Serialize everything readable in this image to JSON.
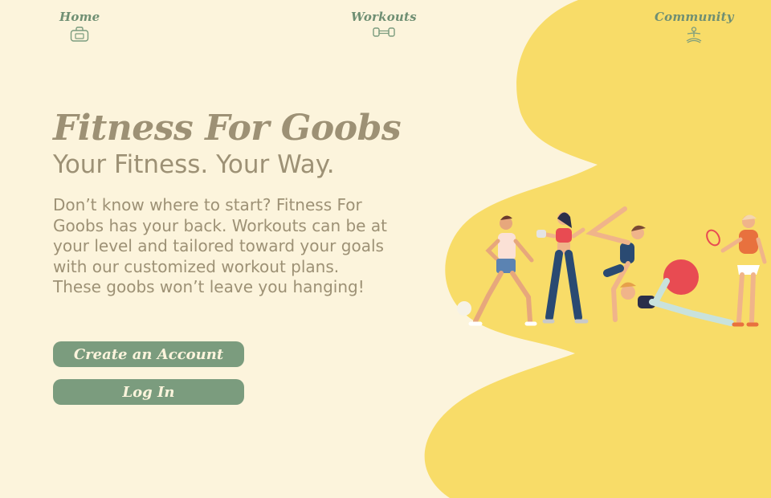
{
  "nav": {
    "items": [
      {
        "label": "Home",
        "icon": "gym-bag-icon"
      },
      {
        "label": "Workouts",
        "icon": "dumbbell-icon"
      },
      {
        "label": "Community",
        "icon": "meditation-person-icon"
      }
    ]
  },
  "hero": {
    "title": "Fitness For Goobs",
    "subtitle": "Your Fitness. Your Way.",
    "description": "Don’t know where to start? Fitness For Goobs has your back.  Workouts can be at your level and tailored toward your goals with our customized workout plans. These goobs won’t leave you hanging!"
  },
  "buttons": {
    "create_account": "Create an Account",
    "login": "Log In"
  },
  "colors": {
    "background": "#fcf4dc",
    "blob": "#f8dc68",
    "accent_green": "#7b9c7e",
    "text_brown": "#9d9175"
  }
}
